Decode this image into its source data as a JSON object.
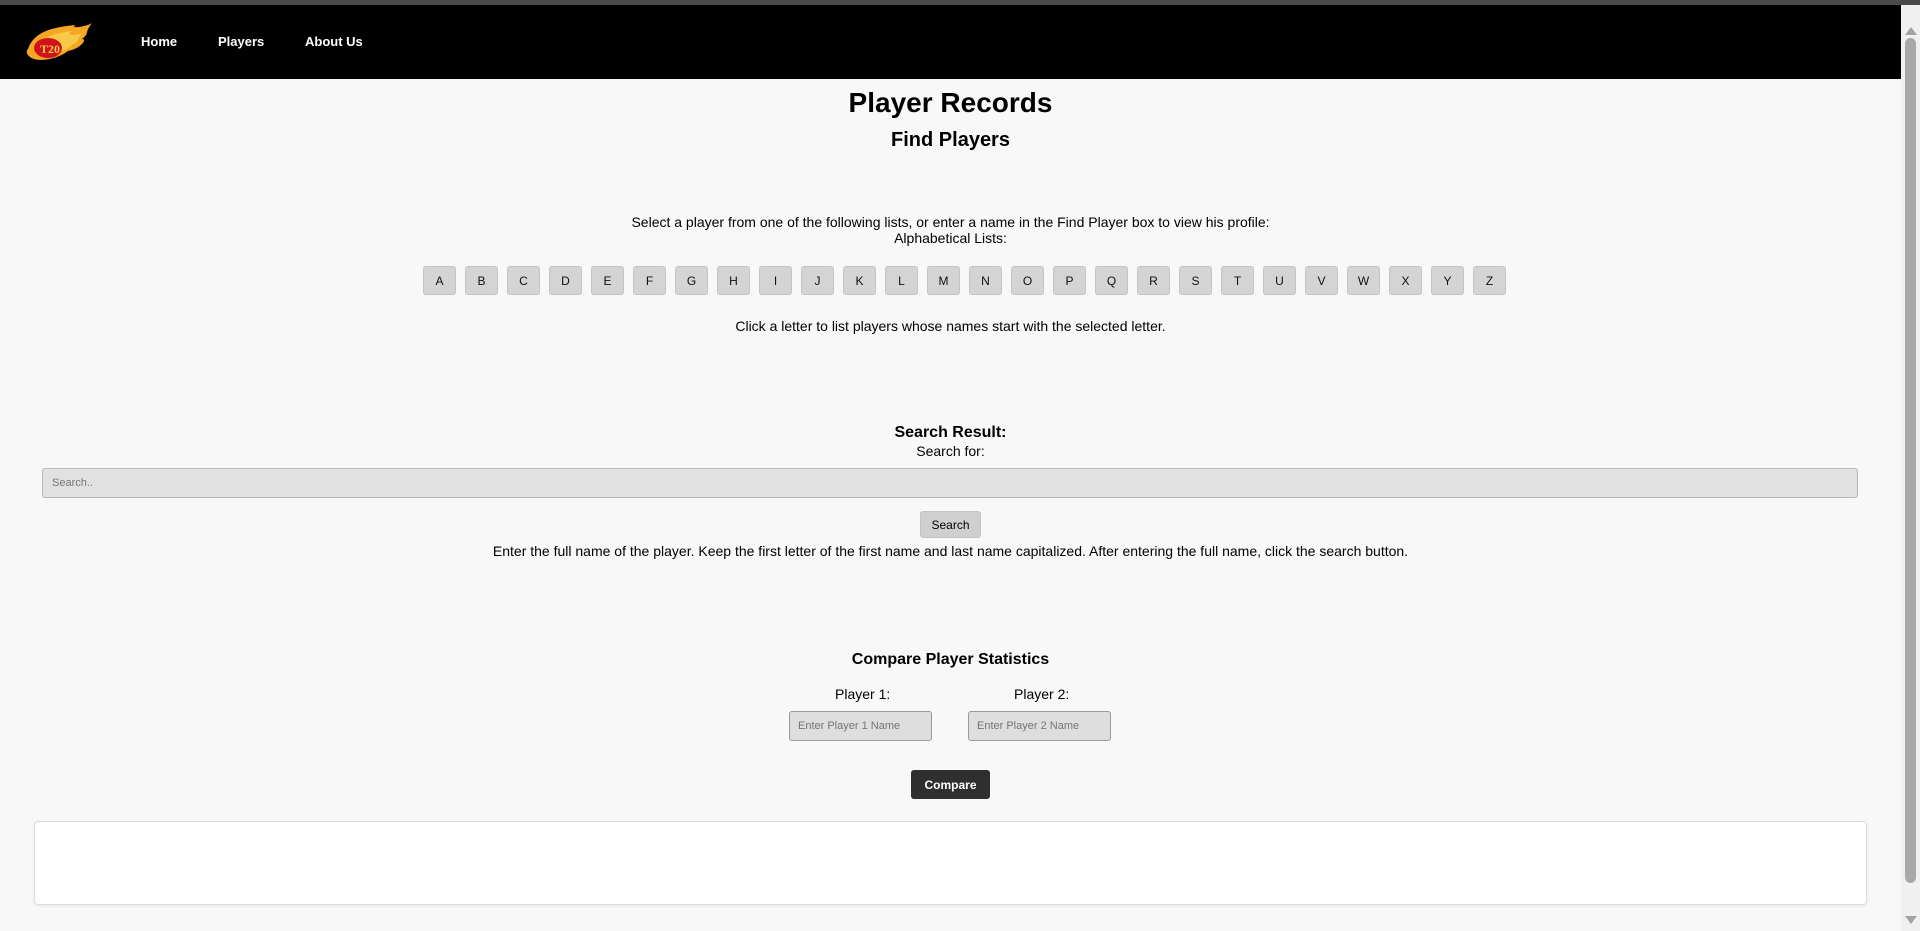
{
  "nav": {
    "logo_text": "T20",
    "items": [
      {
        "label": "Home"
      },
      {
        "label": "Players"
      },
      {
        "label": "About Us"
      }
    ]
  },
  "main": {
    "title": "Player Records",
    "subtitle": "Find Players",
    "intro": "Select a player from one of the following lists, or enter a name in the Find Player box to view his profile:",
    "alpha_heading": "Alphabetical Lists:",
    "letters": [
      "A",
      "B",
      "C",
      "D",
      "E",
      "F",
      "G",
      "H",
      "I",
      "J",
      "K",
      "L",
      "M",
      "N",
      "O",
      "P",
      "Q",
      "R",
      "S",
      "T",
      "U",
      "V",
      "W",
      "X",
      "Y",
      "Z"
    ],
    "letter_hint": "Click a letter to list players whose names start with the selected letter."
  },
  "search": {
    "heading": "Search Result:",
    "label": "Search for:",
    "placeholder": "Search..",
    "button": "Search",
    "hint": "Enter the full name of the player. Keep the first letter of the first name and last name capitalized. After entering the full name, click the search button."
  },
  "compare": {
    "heading": "Compare Player Statistics",
    "player1_label": "Player 1:",
    "player1_placeholder": "Enter Player 1 Name",
    "player2_label": "Player 2:",
    "player2_placeholder": "Enter Player 2 Name",
    "button": "Compare"
  },
  "colors": {
    "navbar": "#000000",
    "page_bg": "#f8f8f8",
    "compare_button": "#2f2f2f",
    "logo_flame": "#f5a623",
    "logo_red": "#d0121b"
  }
}
